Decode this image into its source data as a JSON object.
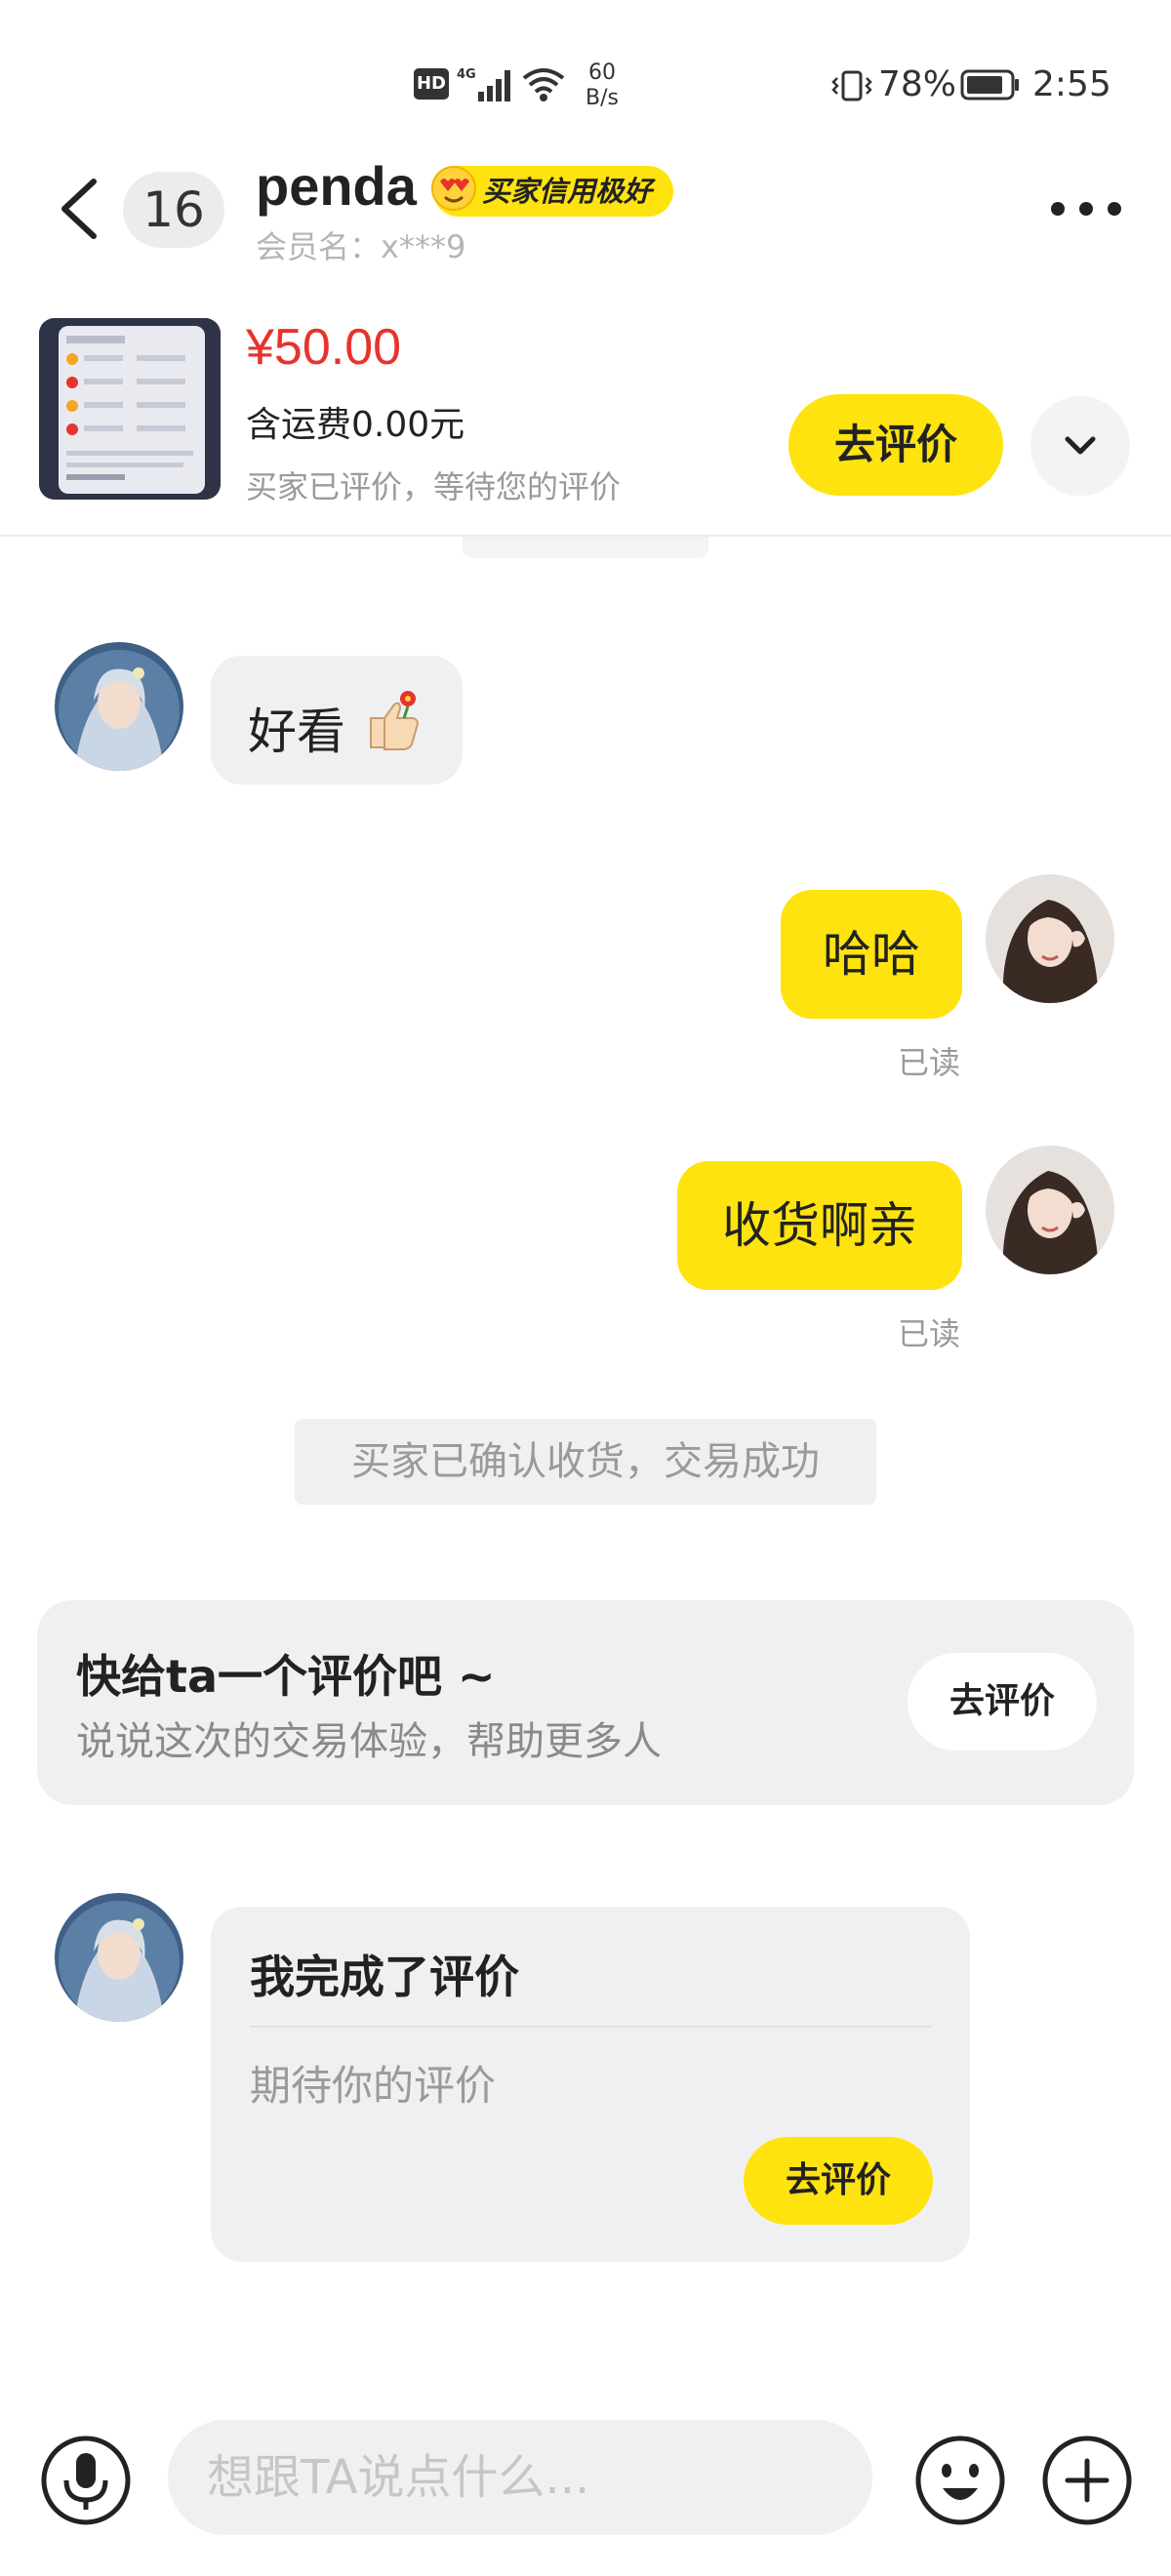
{
  "status_bar": {
    "network_hd": "HD",
    "network_gen": "4G",
    "speed_value": "60",
    "speed_unit": "B/s",
    "battery": "78%",
    "time": "2:55"
  },
  "header": {
    "unread_count": "16",
    "contact_name": "penda",
    "credit_badge": "买家信用极好",
    "member_name": "会员名：x***9"
  },
  "product": {
    "price": "¥50.00",
    "shipping": "含运费0.00元",
    "status": "买家已评价，等待您的评价",
    "review_button": "去评价"
  },
  "messages": {
    "incoming_1": {
      "text": "好看",
      "emoji": "👍🌹"
    },
    "outgoing_1": {
      "text": "哈哈",
      "status": "已读"
    },
    "outgoing_2": {
      "text": "收货啊亲",
      "status": "已读"
    },
    "system_notice": "买家已确认收货，交易成功"
  },
  "review_prompt": {
    "title": "快给ta一个评价吧 ~",
    "subtitle": "说说这次的交易体验，帮助更多人",
    "button": "去评价"
  },
  "review_card": {
    "title": "我完成了评价",
    "text": "期待你的评价",
    "button": "去评价"
  },
  "input_bar": {
    "placeholder": "想跟TA说点什么..."
  },
  "colors": {
    "accent_yellow": "#ffe30f",
    "price_red": "#e8322d",
    "bubble_gray": "#f0f0f2"
  },
  "icons": [
    "back-icon",
    "more-icon",
    "chevron-down-icon",
    "mic-icon",
    "emoji-icon",
    "plus-icon",
    "signal-icon",
    "wifi-icon",
    "battery-icon",
    "vibrate-icon"
  ]
}
